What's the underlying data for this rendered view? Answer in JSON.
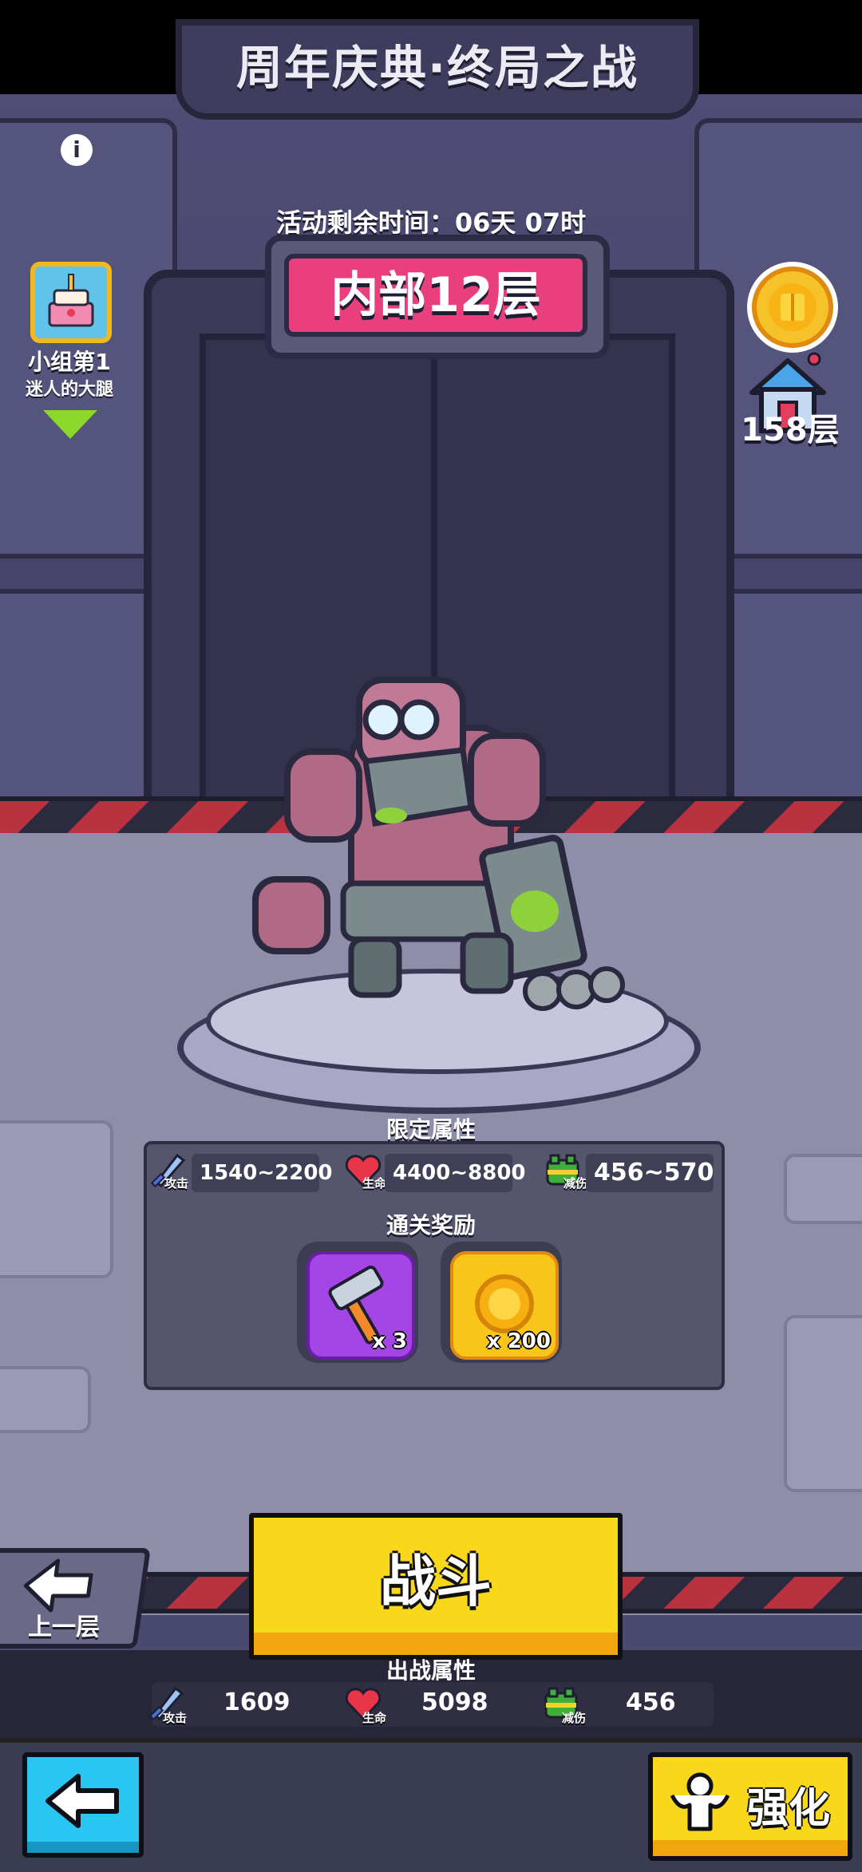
{
  "event": {
    "title": "周年庆典·终局之战",
    "timer_label": "活动剩余时间：",
    "timer_value": "06天 07时",
    "floor_name": "内部12层"
  },
  "rank": {
    "label": "小组第1",
    "name": "迷人的大腿"
  },
  "home": {
    "level": "158层"
  },
  "enemy_stats": {
    "section_label": "限定属性",
    "attack": {
      "sub": "攻击",
      "value": "1540~2200"
    },
    "hp": {
      "sub": "生命",
      "value": "4400~8800"
    },
    "defense": {
      "sub": "减伤",
      "value": "456~570"
    }
  },
  "rewards": {
    "section_label": "通关奖励",
    "items": [
      {
        "name": "hammer",
        "count": "x 3"
      },
      {
        "name": "gold-medal",
        "count": "x 200"
      }
    ]
  },
  "actions": {
    "fight": "战斗",
    "previous_floor": "上一层",
    "upgrade": "强化"
  },
  "player_stats": {
    "section_label": "出战属性",
    "attack": {
      "sub": "攻击",
      "value": "1609"
    },
    "hp": {
      "sub": "生命",
      "value": "5098"
    },
    "defense": {
      "sub": "减伤",
      "value": "456"
    }
  },
  "colors": {
    "floor_badge": "#ea3f7d",
    "fight_button": "#f9d71b",
    "back_button": "#29c6f3"
  }
}
